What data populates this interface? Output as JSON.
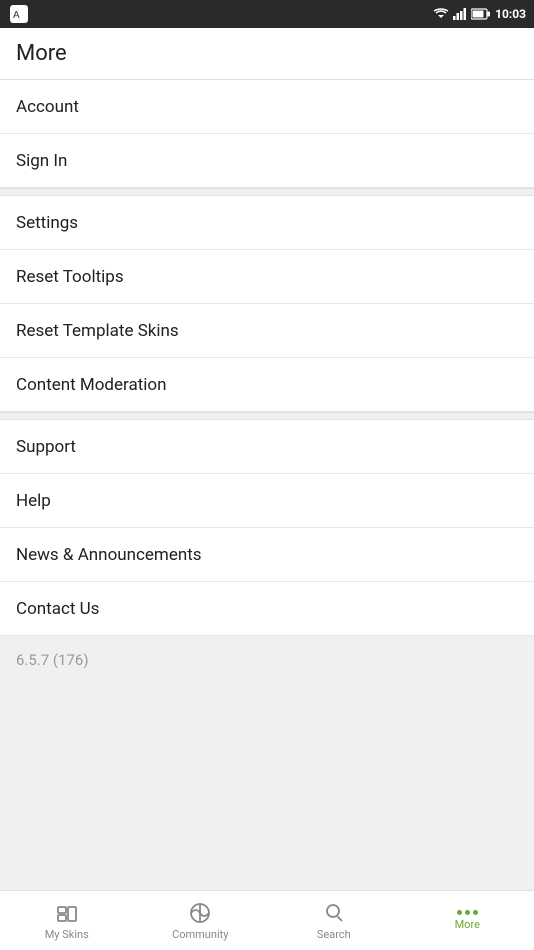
{
  "statusBar": {
    "time": "10:03"
  },
  "header": {
    "title": "More"
  },
  "menuItems": [
    {
      "id": "account",
      "label": "Account",
      "section": 1
    },
    {
      "id": "sign-in",
      "label": "Sign In",
      "section": 1
    },
    {
      "id": "settings",
      "label": "Settings",
      "section": 2
    },
    {
      "id": "reset-tooltips",
      "label": "Reset Tooltips",
      "section": 2
    },
    {
      "id": "reset-template-skins",
      "label": "Reset Template Skins",
      "section": 2
    },
    {
      "id": "content-moderation",
      "label": "Content Moderation",
      "section": 2
    },
    {
      "id": "support",
      "label": "Support",
      "section": 3
    },
    {
      "id": "help",
      "label": "Help",
      "section": 3
    },
    {
      "id": "news-announcements",
      "label": "News & Announcements",
      "section": 3
    },
    {
      "id": "contact-us",
      "label": "Contact Us",
      "section": 3
    }
  ],
  "version": {
    "text": "6.5.7 (176)"
  },
  "bottomNav": {
    "items": [
      {
        "id": "my-skins",
        "label": "My Skins",
        "active": false
      },
      {
        "id": "community",
        "label": "Community",
        "active": false
      },
      {
        "id": "search",
        "label": "Search",
        "active": false
      },
      {
        "id": "more",
        "label": "More",
        "active": true
      }
    ]
  }
}
